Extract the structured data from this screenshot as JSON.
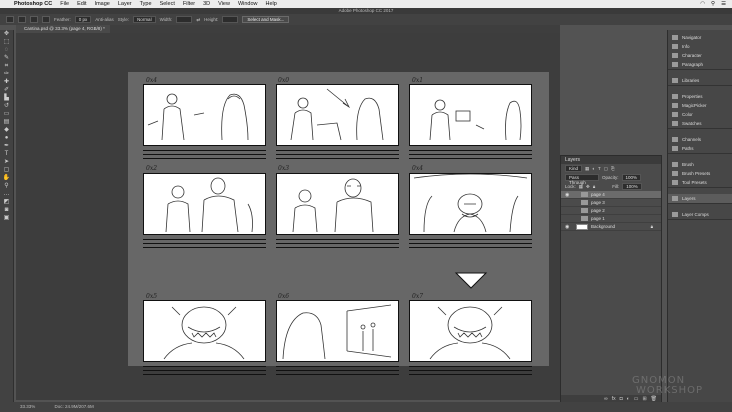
{
  "menubar": {
    "app_name": "Photoshop CC",
    "items": [
      "File",
      "Edit",
      "Image",
      "Layer",
      "Type",
      "Select",
      "Filter",
      "3D",
      "View",
      "Window",
      "Help"
    ]
  },
  "title": "Adobe Photoshop CC 2017",
  "options_bar": {
    "feather_label": "Feather:",
    "feather_value": "0 px",
    "antialias_label": "Anti-alias",
    "style_label": "Style:",
    "style_value": "Normal",
    "width_label": "Width:",
    "height_label": "Height:",
    "select_mask_label": "Select and Mask..."
  },
  "document_tab": "Cantina.psd @ 33.3% (page 4, RGB/8) *",
  "panel_numbers": [
    "0x4",
    "0x0",
    "0x1",
    "0x2",
    "0x3",
    "0x4",
    "0x5",
    "0x6",
    "0x7"
  ],
  "layers_panel": {
    "title": "Layers",
    "kind_label": "Kind",
    "blend_mode": "Pass Through",
    "opacity_label": "Opacity:",
    "opacity_value": "100%",
    "lock_label": "Lock:",
    "fill_label": "Fill:",
    "fill_value": "100%",
    "layers": [
      {
        "name": "page 4",
        "type": "group",
        "selected": true
      },
      {
        "name": "page 3",
        "type": "group",
        "selected": false
      },
      {
        "name": "page 2",
        "type": "group",
        "selected": false
      },
      {
        "name": "page 1",
        "type": "group",
        "selected": false
      },
      {
        "name": "Background",
        "type": "layer",
        "selected": false
      }
    ]
  },
  "dock": {
    "group1": [
      "Navigator",
      "Info",
      "Character",
      "Paragraph"
    ],
    "group2": [
      "Libraries"
    ],
    "group3": [
      "Properties",
      "MagicPicker",
      "Color",
      "Swatches"
    ],
    "group4": [
      "Channels",
      "Paths"
    ],
    "group5": [
      "Brush",
      "Brush Presets",
      "Tool Presets"
    ],
    "group6": [
      "Layers"
    ],
    "group7": [
      "Layer Comps"
    ]
  },
  "status": {
    "zoom": "33.33%",
    "doc": "Doc: 24.9M/207.6M"
  },
  "watermark": {
    "line1": "GNOMON",
    "line2": "WORKSHOP"
  }
}
